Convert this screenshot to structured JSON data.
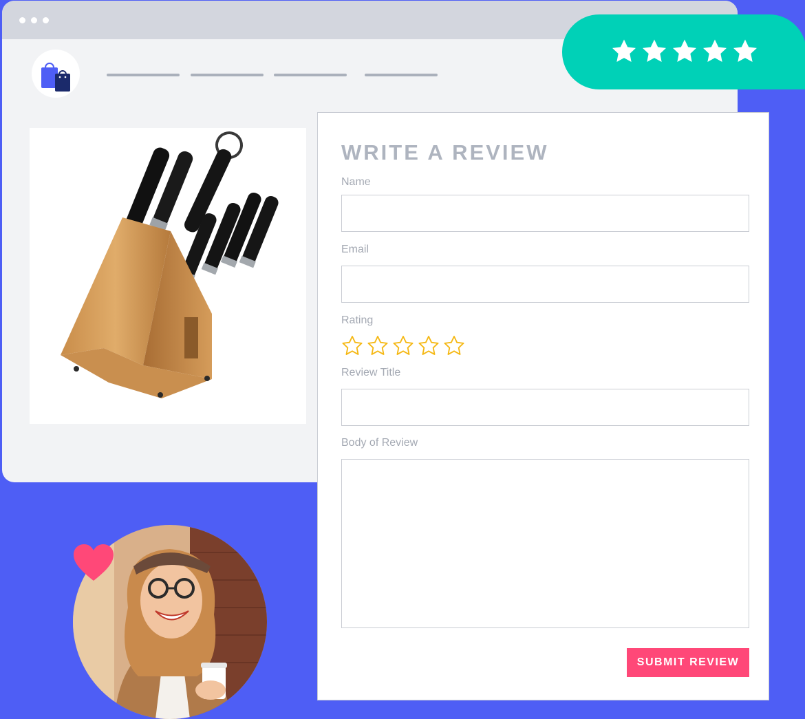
{
  "colors": {
    "background": "#4e5ef5",
    "badge": "#00d1b7",
    "star_outline": "#f5b814",
    "submit": "#ff4878",
    "heart": "#ff4878"
  },
  "browser": {
    "icons": [
      "window-dots-icon",
      "shopping-bags-icon"
    ],
    "nav_items": 4
  },
  "badge": {
    "stars": 5,
    "icon": "star-icon"
  },
  "product": {
    "image": "knife-block-set"
  },
  "form": {
    "title": "WRITE A REVIEW",
    "name_label": "Name",
    "name_value": "",
    "email_label": "Email",
    "email_value": "",
    "rating_label": "Rating",
    "rating_value": 0,
    "rating_max": 5,
    "review_title_label": "Review Title",
    "review_title_value": "",
    "body_label": "Body of Review",
    "body_value": "",
    "submit_label": "SUBMIT REVIEW"
  },
  "reviewer": {
    "image": "smiling-woman-photo",
    "icon": "heart-icon"
  }
}
